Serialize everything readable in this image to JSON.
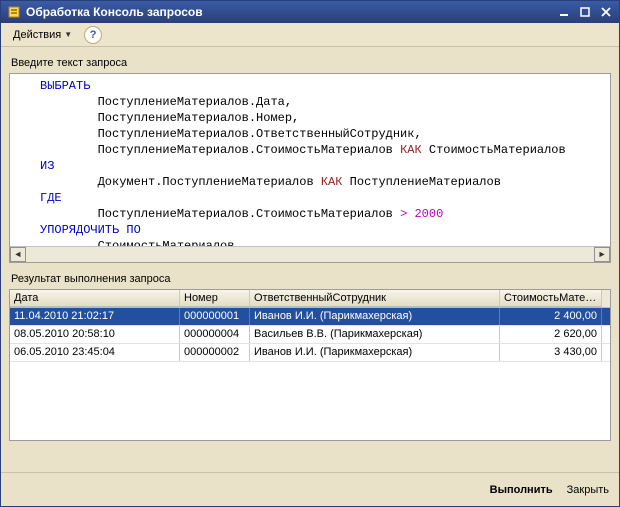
{
  "window": {
    "title": "Обработка  Консоль запросов"
  },
  "toolbar": {
    "actions_label": "Действия"
  },
  "labels": {
    "query_prompt": "Введите текст запроса",
    "result_label": "Результат выполнения запроса"
  },
  "query_tokens": [
    {
      "indent": 0,
      "parts": [
        {
          "t": "ВЫБРАТЬ",
          "c": "kw"
        }
      ]
    },
    {
      "indent": 2,
      "parts": [
        {
          "t": "ПоступлениеМатериалов.Дата,",
          "c": ""
        }
      ]
    },
    {
      "indent": 2,
      "parts": [
        {
          "t": "ПоступлениеМатериалов.Номер,",
          "c": ""
        }
      ]
    },
    {
      "indent": 2,
      "parts": [
        {
          "t": "ПоступлениеМатериалов.ОтветственныйСотрудник,",
          "c": ""
        }
      ]
    },
    {
      "indent": 2,
      "parts": [
        {
          "t": "ПоступлениеМатериалов.СтоимостьМатериалов ",
          "c": ""
        },
        {
          "t": "КАК",
          "c": "kwred"
        },
        {
          "t": " СтоимостьМатериалов",
          "c": ""
        }
      ]
    },
    {
      "indent": 0,
      "parts": [
        {
          "t": "ИЗ",
          "c": "kw"
        }
      ]
    },
    {
      "indent": 2,
      "parts": [
        {
          "t": "Документ.ПоступлениеМатериалов ",
          "c": ""
        },
        {
          "t": "КАК",
          "c": "kwred"
        },
        {
          "t": " ПоступлениеМатериалов",
          "c": ""
        }
      ]
    },
    {
      "indent": 0,
      "parts": [
        {
          "t": "ГДЕ",
          "c": "kw"
        }
      ]
    },
    {
      "indent": 2,
      "parts": [
        {
          "t": "ПоступлениеМатериалов.СтоимостьМатериалов ",
          "c": ""
        },
        {
          "t": ">",
          "c": "op"
        },
        {
          "t": " ",
          "c": ""
        },
        {
          "t": "2000",
          "c": "op"
        }
      ]
    },
    {
      "indent": 0,
      "parts": [
        {
          "t": "",
          "c": ""
        }
      ]
    },
    {
      "indent": 0,
      "parts": [
        {
          "t": "УПОРЯДОЧИТЬ ПО",
          "c": "kw"
        }
      ]
    },
    {
      "indent": 2,
      "parts": [
        {
          "t": "СтоимостьМатериалов",
          "c": ""
        }
      ]
    }
  ],
  "grid": {
    "columns": [
      "Дата",
      "Номер",
      "ОтветственныйСотрудник",
      "СтоимостьМатериалов"
    ],
    "rows": [
      {
        "date": "11.04.2010 21:02:17",
        "num": "000000001",
        "emp": "Иванов И.И. (Парикмахерская)",
        "cost": "2 400,00",
        "selected": true
      },
      {
        "date": "08.05.2010 20:58:10",
        "num": "000000004",
        "emp": "Васильев В.В. (Парикмахерская)",
        "cost": "2 620,00",
        "selected": false
      },
      {
        "date": "06.05.2010 23:45:04",
        "num": "000000002",
        "emp": "Иванов И.И. (Парикмахерская)",
        "cost": "3 430,00",
        "selected": false
      }
    ]
  },
  "buttons": {
    "execute": "Выполнить",
    "close": "Закрыть"
  }
}
